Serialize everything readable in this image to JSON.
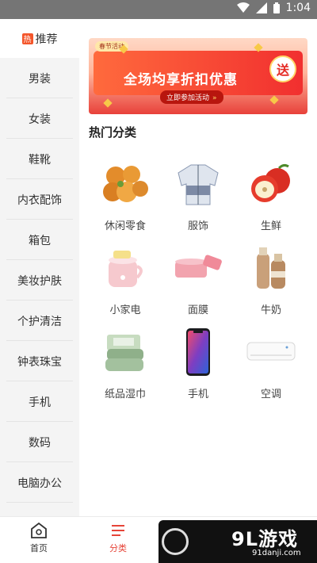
{
  "status_bar": {
    "time": "1:04"
  },
  "sidebar": {
    "hot_badge": "热",
    "items": [
      {
        "label": "推荐"
      },
      {
        "label": "男装"
      },
      {
        "label": "女装"
      },
      {
        "label": "鞋靴"
      },
      {
        "label": "内衣配饰"
      },
      {
        "label": "箱包"
      },
      {
        "label": "美妆护肤"
      },
      {
        "label": "个护清洁"
      },
      {
        "label": "钟表珠宝"
      },
      {
        "label": "手机"
      },
      {
        "label": "数码"
      },
      {
        "label": "电脑办公"
      }
    ]
  },
  "banner": {
    "tag": "春节活动",
    "headline": "全场均享折扣优惠",
    "cta": "立即参加活动",
    "badge": "送"
  },
  "section_title": "热门分类",
  "categories": [
    {
      "label": "休闲零食",
      "icon": "snack-icon"
    },
    {
      "label": "服饰",
      "icon": "jacket-icon"
    },
    {
      "label": "生鲜",
      "icon": "apple-icon"
    },
    {
      "label": "小家电",
      "icon": "cooker-icon"
    },
    {
      "label": "面膜",
      "icon": "mask-jar-icon"
    },
    {
      "label": "牛奶",
      "icon": "milk-bottle-icon"
    },
    {
      "label": "纸品湿巾",
      "icon": "tissue-icon"
    },
    {
      "label": "手机",
      "icon": "phone-icon"
    },
    {
      "label": "空调",
      "icon": "air-conditioner-icon"
    }
  ],
  "bottom_nav": {
    "items": [
      {
        "label": "首页",
        "icon": "home-icon"
      },
      {
        "label": "分类",
        "icon": "category-icon"
      }
    ]
  },
  "watermark": {
    "brand": "9L游戏",
    "url": "91danji.com"
  },
  "colors": {
    "accent": "#e64438",
    "sidebar_bg": "#f4f4f4",
    "status_bar": "#757575"
  }
}
